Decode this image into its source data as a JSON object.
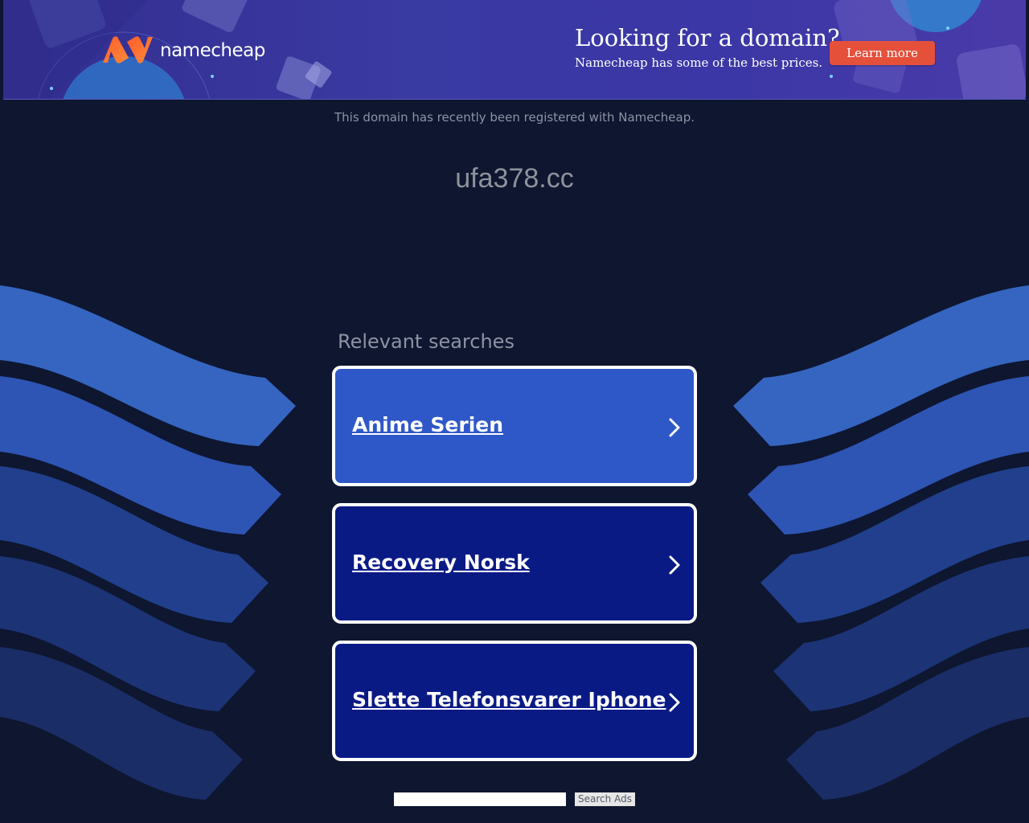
{
  "banner": {
    "brand": "namecheap",
    "headline": "Looking for a domain?",
    "subline": "Namecheap has some of the best prices.",
    "cta_label": "Learn more",
    "logo_icon": "namecheap-logo-icon",
    "brand_color": "#ff6a2b"
  },
  "notice": "This domain has recently been registered with Namecheap.",
  "domain": "ufa378.cc",
  "relevant": {
    "title": "Relevant searches",
    "items": [
      {
        "label": "Anime Serien",
        "icon": "chevron-right-icon"
      },
      {
        "label": "Recovery Norsk",
        "icon": "chevron-right-icon"
      },
      {
        "label": "Slette Telefonsvarer Iphone",
        "icon": "chevron-right-icon"
      }
    ]
  },
  "search": {
    "input_value": "",
    "button_label": "Search Ads"
  },
  "colors": {
    "background": "#0e1630",
    "result_primary": "#2e57c8",
    "result_secondary": "#0a1a85",
    "cta": "#e5503b"
  }
}
